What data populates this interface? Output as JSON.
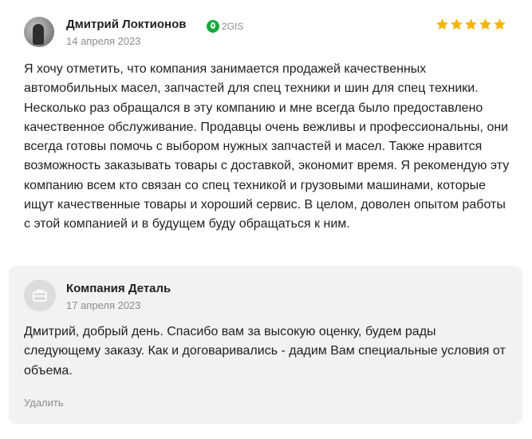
{
  "review": {
    "author": "Дмитрий Локтионов",
    "source": "2GIS",
    "date": "14 апреля 2023",
    "rating": 5,
    "star_color": "#f5b400",
    "text": "Я хочу отметить, что компания занимается продажей качественных автомобильных масел, запчастей для спец техники и шин для спец техники. Несколько раз обращался в эту компанию и мне всегда было предоставлено качественное обслуживание. Продавцы очень вежливы и профессиональны, они всегда готовы помочь с выбором нужных запчастей и масел. Также нравится возможность заказывать товары с доставкой, экономит время. Я рекомендую эту компанию всем кто связан со спец техникой и грузовыми машинами, которые ищут качественные товары и хороший сервис. В целом, доволен опытом работы с этой компанией и в будущем буду обращаться к ним."
  },
  "reply": {
    "company": "Компания Деталь",
    "date": "17 апреля 2023",
    "text": "Дмитрий, добрый день. Спасибо вам за высокую оценку, будем рады следующему заказу. Как и договаривались - дадим Вам специальные условия от объема.",
    "delete_label": "Удалить"
  },
  "colors": {
    "source_green": "#19a83d",
    "muted_text": "#8c8c8c",
    "reply_background": "#f2f2f2"
  }
}
